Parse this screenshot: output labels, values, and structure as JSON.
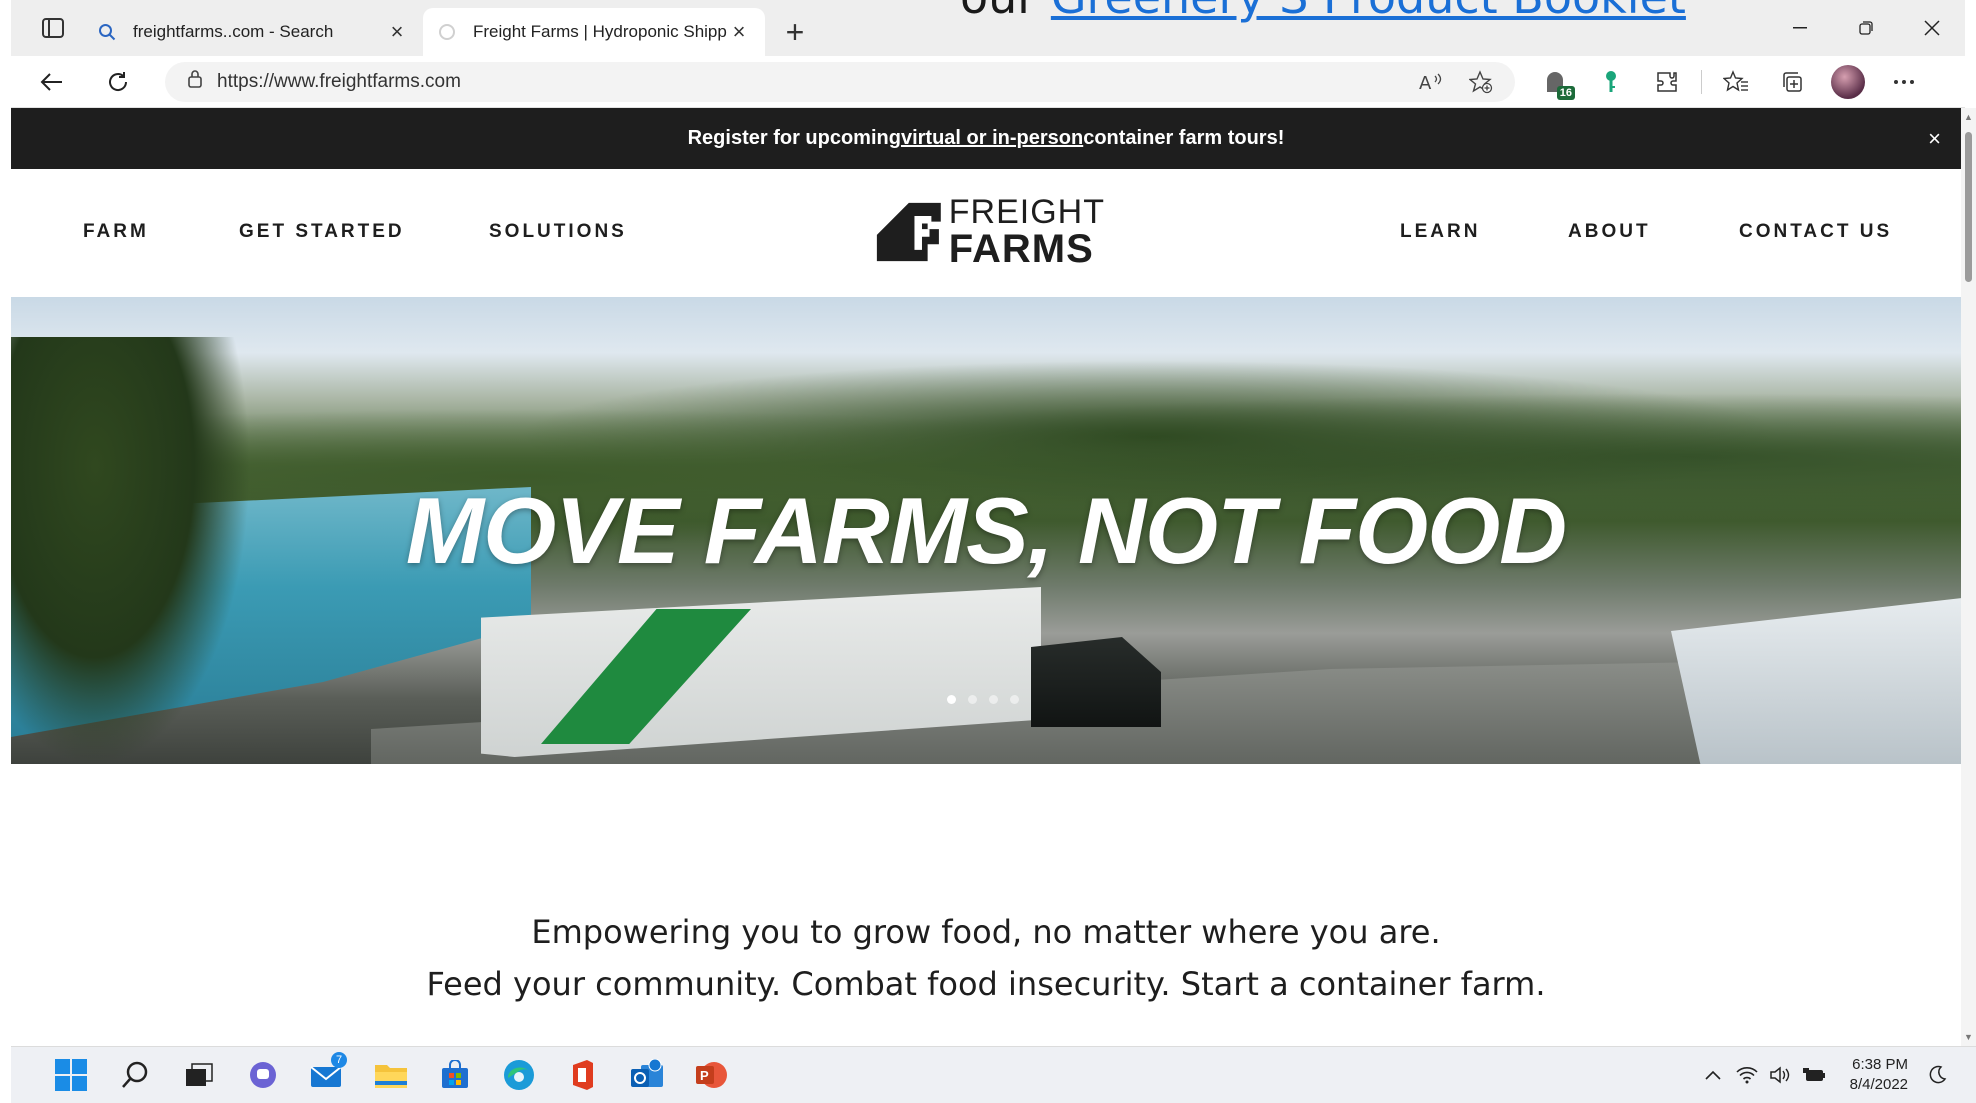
{
  "overflow_text": {
    "prefix": "our ",
    "link": "Greenery S Product Booklet"
  },
  "browser": {
    "tabs": [
      {
        "title": "freightfarms..com - Search",
        "active": false
      },
      {
        "title": "Freight Farms | Hydroponic Shipp",
        "active": true
      }
    ],
    "url": "https://www.freightfarms.com",
    "extension_badge": "16"
  },
  "announcement": {
    "before": "Register for upcoming ",
    "link": "virtual or in-person ",
    "after": "container farm tours!",
    "close": "×"
  },
  "nav": {
    "left": [
      "FARM",
      "GET STARTED",
      "SOLUTIONS"
    ],
    "right": [
      "LEARN",
      "ABOUT",
      "CONTACT US"
    ],
    "logo_line1": "FREIGHT",
    "logo_line2": "FARMS"
  },
  "hero": {
    "title": "MOVE FARMS, NOT FOOD",
    "slides": 4,
    "active_slide": 1
  },
  "tagline": {
    "line1": "Empowering you to grow food, no matter where you are.",
    "line2": "Feed your community. Combat food insecurity. Start a container farm."
  },
  "taskbar": {
    "mail_badge": "7",
    "time": "6:38 PM",
    "date": "8/4/2022"
  },
  "colors": {
    "announcement_bg": "#1e1e1e",
    "brand_green": "#1f8a3f",
    "link_blue": "#1a6fd6"
  }
}
